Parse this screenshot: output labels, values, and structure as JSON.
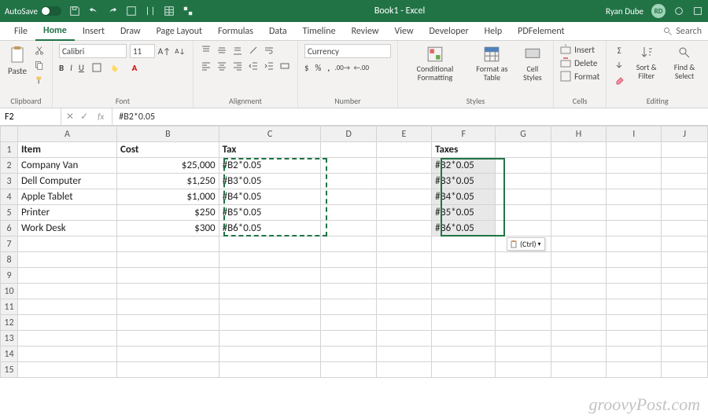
{
  "titlebar": {
    "autosave_label": "AutoSave",
    "title": "Book1 - Excel",
    "username": "Ryan Dube",
    "avatar_initials": "RD"
  },
  "tabs": {
    "items": [
      "File",
      "Home",
      "Insert",
      "Draw",
      "Page Layout",
      "Formulas",
      "Data",
      "Timeline",
      "Review",
      "View",
      "Developer",
      "Help",
      "PDFelement"
    ],
    "active": "Home",
    "search": "Search"
  },
  "ribbon": {
    "clipboard": {
      "label": "Clipboard",
      "paste": "Paste"
    },
    "font": {
      "label": "Font",
      "name": "Calibri",
      "size": "11",
      "bold": "B",
      "italic": "I",
      "underline": "U"
    },
    "alignment": {
      "label": "Alignment"
    },
    "number": {
      "label": "Number",
      "format": "Currency",
      "dollar": "$",
      "percent": "%",
      "comma": ","
    },
    "styles": {
      "label": "Styles",
      "cond": "Conditional Formatting",
      "table": "Format as Table",
      "cell": "Cell Styles"
    },
    "cells": {
      "label": "Cells",
      "insert": "Insert",
      "delete": "Delete",
      "format": "Format"
    },
    "editing": {
      "label": "Editing",
      "sort": "Sort & Filter",
      "find": "Find & Select"
    }
  },
  "formulabar": {
    "cellref": "F2",
    "formula": "#B2*0.05",
    "fx": "fx"
  },
  "columns": [
    "A",
    "B",
    "C",
    "D",
    "E",
    "F",
    "G",
    "H",
    "I",
    "J"
  ],
  "headers": {
    "A": "Item",
    "B": "Cost",
    "C": "Tax",
    "F": "Taxes"
  },
  "rows": [
    {
      "r": "2",
      "A": "Company Van",
      "B": "$25,000",
      "C": "#B2*0.05",
      "F": "#B2*0.05"
    },
    {
      "r": "3",
      "A": "Dell Computer",
      "B": "$1,250",
      "C": "#B3*0.05",
      "F": "#B3*0.05"
    },
    {
      "r": "4",
      "A": "Apple Tablet",
      "B": "$1,000",
      "C": "#B4*0.05",
      "F": "#B4*0.05"
    },
    {
      "r": "5",
      "A": "Printer",
      "B": "$250",
      "C": "#B5*0.05",
      "F": "#B5*0.05"
    },
    {
      "r": "6",
      "A": "Work Desk",
      "B": "$300",
      "C": "#B6*0.05",
      "F": "#B6*0.05"
    }
  ],
  "empty_rows": [
    "7",
    "8",
    "9",
    "10",
    "11",
    "12",
    "13",
    "14",
    "15"
  ],
  "paste_hint": "(Ctrl)",
  "watermark": "groovyPost.com"
}
